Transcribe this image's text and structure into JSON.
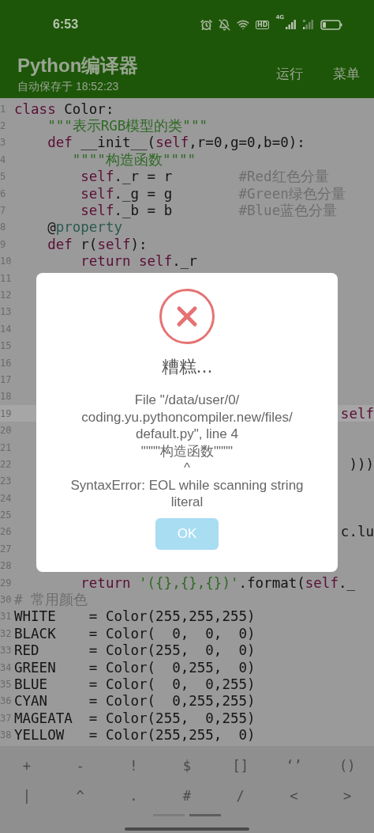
{
  "status_bar": {
    "time": "6:53",
    "hd": "HD",
    "network": "4G"
  },
  "app_bar": {
    "title": "Python编译器",
    "subtitle": "自动保存于 18:52:23",
    "actions": [
      "运行",
      "菜单"
    ]
  },
  "editor": {
    "lines": [
      {
        "number": "1",
        "current": false,
        "tokens": [
          {
            "kind": "keyword",
            "text": "class"
          },
          {
            "kind": "plain",
            "text": " Color:"
          }
        ]
      },
      {
        "number": "2",
        "current": false,
        "tokens": [
          {
            "kind": "string",
            "text": "    \"\"\"表示RGB模型的类\"\"\""
          }
        ]
      },
      {
        "number": "3",
        "current": false,
        "tokens": [
          {
            "kind": "keyword",
            "text": "    def"
          },
          {
            "kind": "plain",
            "text": " __init__("
          },
          {
            "kind": "keyword",
            "text": "self"
          },
          {
            "kind": "plain",
            "text": ",r=0,g=0,b=0):"
          }
        ]
      },
      {
        "number": "4",
        "current": false,
        "tokens": [
          {
            "kind": "string",
            "text": "       \"\"\"\"构造函数\"\"\"\""
          }
        ]
      },
      {
        "number": "5",
        "current": false,
        "tokens": [
          {
            "kind": "keyword",
            "text": "        self"
          },
          {
            "kind": "plain",
            "text": "._r = r"
          },
          {
            "kind": "comment",
            "text": "        #Red红色分量"
          }
        ]
      },
      {
        "number": "6",
        "current": false,
        "tokens": [
          {
            "kind": "keyword",
            "text": "        self"
          },
          {
            "kind": "plain",
            "text": "._g = g"
          },
          {
            "kind": "comment",
            "text": "        #Green绿色分量"
          }
        ]
      },
      {
        "number": "7",
        "current": false,
        "tokens": [
          {
            "kind": "keyword",
            "text": "        self"
          },
          {
            "kind": "plain",
            "text": "._b = b"
          },
          {
            "kind": "comment",
            "text": "        #Blue蓝色分量"
          }
        ]
      },
      {
        "number": "8",
        "current": false,
        "tokens": [
          {
            "kind": "plain",
            "text": "    @"
          },
          {
            "kind": "decorator",
            "text": "property"
          }
        ]
      },
      {
        "number": "9",
        "current": false,
        "tokens": [
          {
            "kind": "keyword",
            "text": "    def"
          },
          {
            "kind": "plain",
            "text": " r("
          },
          {
            "kind": "keyword",
            "text": "self"
          },
          {
            "kind": "plain",
            "text": "):"
          }
        ]
      },
      {
        "number": "10",
        "current": false,
        "tokens": [
          {
            "kind": "keyword",
            "text": "        return self"
          },
          {
            "kind": "plain",
            "text": "._r"
          }
        ]
      },
      {
        "number": "11",
        "current": false
      },
      {
        "number": "12",
        "current": false
      },
      {
        "number": "13",
        "current": false
      },
      {
        "number": "14",
        "current": false
      },
      {
        "number": "15",
        "current": false
      },
      {
        "number": "16",
        "current": false
      },
      {
        "number": "17",
        "current": false
      },
      {
        "number": "18",
        "current": false
      },
      {
        "number": "19",
        "current": true,
        "tail": {
          "kind": "keyword",
          "text": "self"
        }
      },
      {
        "number": "20",
        "current": false
      },
      {
        "number": "21",
        "current": false
      },
      {
        "number": "22",
        "current": false,
        "tail": {
          "kind": "plain",
          "text": ")))"
        }
      },
      {
        "number": "23",
        "current": false
      },
      {
        "number": "24",
        "current": false
      },
      {
        "number": "25",
        "current": false
      },
      {
        "number": "26",
        "current": false,
        "tail": {
          "kind": "plain",
          "text": "c.lu"
        }
      },
      {
        "number": "27",
        "current": false
      },
      {
        "number": "28",
        "current": false
      },
      {
        "number": "29",
        "current": false,
        "tokens": [
          {
            "kind": "keyword",
            "text": "        return"
          },
          {
            "kind": "string",
            "text": " '({},{},{})'"
          },
          {
            "kind": "plain",
            "text": ".format("
          },
          {
            "kind": "keyword",
            "text": "self"
          },
          {
            "kind": "plain",
            "text": "._"
          }
        ]
      },
      {
        "number": "30",
        "current": false,
        "tokens": [
          {
            "kind": "comment",
            "text": "# 常用颜色"
          }
        ]
      },
      {
        "number": "31",
        "current": false,
        "tokens": [
          {
            "kind": "plain",
            "text": "WHITE    = Color(255,255,255)"
          }
        ]
      },
      {
        "number": "32",
        "current": false,
        "tokens": [
          {
            "kind": "plain",
            "text": "BLACK    = Color(  0,  0,  0)"
          }
        ]
      },
      {
        "number": "33",
        "current": false,
        "tokens": [
          {
            "kind": "plain",
            "text": "RED      = Color(255,  0,  0)"
          }
        ]
      },
      {
        "number": "34",
        "current": false,
        "tokens": [
          {
            "kind": "plain",
            "text": "GREEN    = Color(  0,255,  0)"
          }
        ]
      },
      {
        "number": "35",
        "current": false,
        "tokens": [
          {
            "kind": "plain",
            "text": "BLUE     = Color(  0,  0,255)"
          }
        ]
      },
      {
        "number": "36",
        "current": false,
        "tokens": [
          {
            "kind": "plain",
            "text": "CYAN     = Color(  0,255,255)"
          }
        ]
      },
      {
        "number": "37",
        "current": false,
        "tokens": [
          {
            "kind": "plain",
            "text": "MAGEATA  = Color(255,  0,255)"
          }
        ]
      },
      {
        "number": "38",
        "current": false,
        "tokens": [
          {
            "kind": "plain",
            "text": "YELLOW   = Color(255,255,  0)"
          }
        ]
      }
    ]
  },
  "dialog": {
    "title": "糟糕...",
    "message": "File \"/data/user/0/\ncoding.yu.pythoncompiler.new/files/\ndefault.py\", line 4\n\"\"\"\"构造函数\"\"\"\"\n      ^\nSyntaxError: EOL while scanning string\nliteral",
    "button": "OK"
  },
  "symbol_bar": {
    "rows": [
      [
        "+",
        "-",
        "!",
        "$",
        "[]",
        "‘’",
        "()"
      ],
      [
        "|",
        "^",
        ".",
        "#",
        "/",
        "<",
        ">"
      ]
    ],
    "pages": [
      {
        "selected": false
      },
      {
        "selected": true
      }
    ]
  }
}
